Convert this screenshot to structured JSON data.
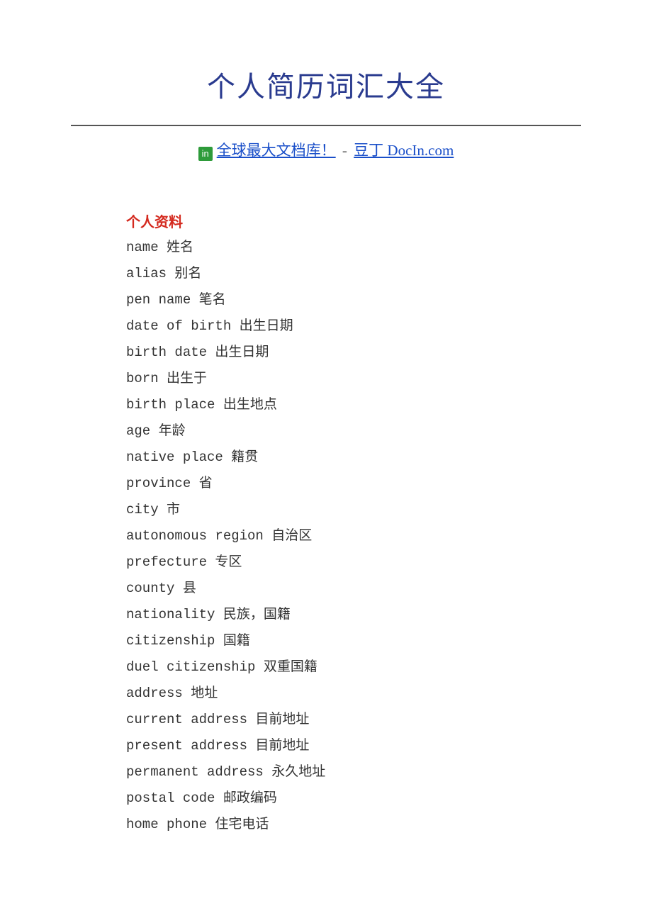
{
  "title": "个人简历词汇大全",
  "link_row": {
    "icon_text": "in",
    "link1": "全球最大文档库！",
    "dash": " - ",
    "link2": "豆丁 DocIn.com"
  },
  "section_heading": "个人资料",
  "terms": [
    "name 姓名",
    "alias 别名",
    "pen name 笔名",
    "date of birth 出生日期",
    "birth date 出生日期",
    "born 出生于",
    "birth place 出生地点",
    "age 年龄",
    "native place 籍贯",
    "province 省",
    "city 市",
    "autonomous region 自治区",
    "prefecture 专区",
    "county 县",
    "nationality 民族，国籍",
    "citizenship 国籍",
    "duel citizenship 双重国籍",
    "address 地址",
    "current address 目前地址",
    "present address 目前地址",
    "permanent address 永久地址",
    "postal code 邮政编码",
    "home phone 住宅电话"
  ]
}
